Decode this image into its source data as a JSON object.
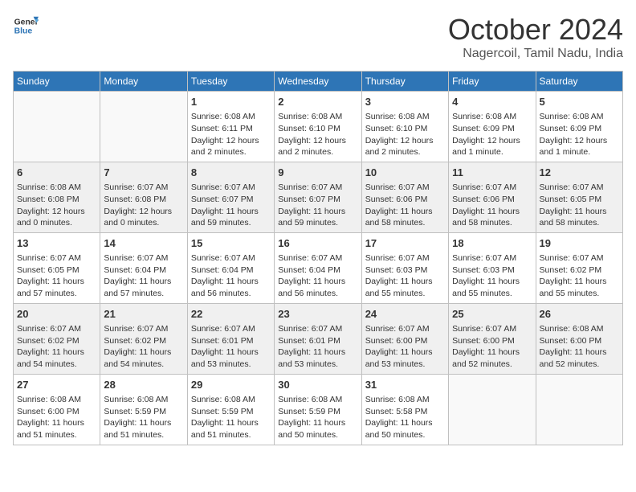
{
  "header": {
    "logo_line1": "General",
    "logo_line2": "Blue",
    "month_year": "October 2024",
    "location": "Nagercoil, Tamil Nadu, India"
  },
  "weekdays": [
    "Sunday",
    "Monday",
    "Tuesday",
    "Wednesday",
    "Thursday",
    "Friday",
    "Saturday"
  ],
  "weeks": [
    [
      {
        "day": "",
        "info": ""
      },
      {
        "day": "",
        "info": ""
      },
      {
        "day": "1",
        "info": "Sunrise: 6:08 AM\nSunset: 6:11 PM\nDaylight: 12 hours\nand 2 minutes."
      },
      {
        "day": "2",
        "info": "Sunrise: 6:08 AM\nSunset: 6:10 PM\nDaylight: 12 hours\nand 2 minutes."
      },
      {
        "day": "3",
        "info": "Sunrise: 6:08 AM\nSunset: 6:10 PM\nDaylight: 12 hours\nand 2 minutes."
      },
      {
        "day": "4",
        "info": "Sunrise: 6:08 AM\nSunset: 6:09 PM\nDaylight: 12 hours\nand 1 minute."
      },
      {
        "day": "5",
        "info": "Sunrise: 6:08 AM\nSunset: 6:09 PM\nDaylight: 12 hours\nand 1 minute."
      }
    ],
    [
      {
        "day": "6",
        "info": "Sunrise: 6:08 AM\nSunset: 6:08 PM\nDaylight: 12 hours\nand 0 minutes."
      },
      {
        "day": "7",
        "info": "Sunrise: 6:07 AM\nSunset: 6:08 PM\nDaylight: 12 hours\nand 0 minutes."
      },
      {
        "day": "8",
        "info": "Sunrise: 6:07 AM\nSunset: 6:07 PM\nDaylight: 11 hours\nand 59 minutes."
      },
      {
        "day": "9",
        "info": "Sunrise: 6:07 AM\nSunset: 6:07 PM\nDaylight: 11 hours\nand 59 minutes."
      },
      {
        "day": "10",
        "info": "Sunrise: 6:07 AM\nSunset: 6:06 PM\nDaylight: 11 hours\nand 58 minutes."
      },
      {
        "day": "11",
        "info": "Sunrise: 6:07 AM\nSunset: 6:06 PM\nDaylight: 11 hours\nand 58 minutes."
      },
      {
        "day": "12",
        "info": "Sunrise: 6:07 AM\nSunset: 6:05 PM\nDaylight: 11 hours\nand 58 minutes."
      }
    ],
    [
      {
        "day": "13",
        "info": "Sunrise: 6:07 AM\nSunset: 6:05 PM\nDaylight: 11 hours\nand 57 minutes."
      },
      {
        "day": "14",
        "info": "Sunrise: 6:07 AM\nSunset: 6:04 PM\nDaylight: 11 hours\nand 57 minutes."
      },
      {
        "day": "15",
        "info": "Sunrise: 6:07 AM\nSunset: 6:04 PM\nDaylight: 11 hours\nand 56 minutes."
      },
      {
        "day": "16",
        "info": "Sunrise: 6:07 AM\nSunset: 6:04 PM\nDaylight: 11 hours\nand 56 minutes."
      },
      {
        "day": "17",
        "info": "Sunrise: 6:07 AM\nSunset: 6:03 PM\nDaylight: 11 hours\nand 55 minutes."
      },
      {
        "day": "18",
        "info": "Sunrise: 6:07 AM\nSunset: 6:03 PM\nDaylight: 11 hours\nand 55 minutes."
      },
      {
        "day": "19",
        "info": "Sunrise: 6:07 AM\nSunset: 6:02 PM\nDaylight: 11 hours\nand 55 minutes."
      }
    ],
    [
      {
        "day": "20",
        "info": "Sunrise: 6:07 AM\nSunset: 6:02 PM\nDaylight: 11 hours\nand 54 minutes."
      },
      {
        "day": "21",
        "info": "Sunrise: 6:07 AM\nSunset: 6:02 PM\nDaylight: 11 hours\nand 54 minutes."
      },
      {
        "day": "22",
        "info": "Sunrise: 6:07 AM\nSunset: 6:01 PM\nDaylight: 11 hours\nand 53 minutes."
      },
      {
        "day": "23",
        "info": "Sunrise: 6:07 AM\nSunset: 6:01 PM\nDaylight: 11 hours\nand 53 minutes."
      },
      {
        "day": "24",
        "info": "Sunrise: 6:07 AM\nSunset: 6:00 PM\nDaylight: 11 hours\nand 53 minutes."
      },
      {
        "day": "25",
        "info": "Sunrise: 6:07 AM\nSunset: 6:00 PM\nDaylight: 11 hours\nand 52 minutes."
      },
      {
        "day": "26",
        "info": "Sunrise: 6:08 AM\nSunset: 6:00 PM\nDaylight: 11 hours\nand 52 minutes."
      }
    ],
    [
      {
        "day": "27",
        "info": "Sunrise: 6:08 AM\nSunset: 6:00 PM\nDaylight: 11 hours\nand 51 minutes."
      },
      {
        "day": "28",
        "info": "Sunrise: 6:08 AM\nSunset: 5:59 PM\nDaylight: 11 hours\nand 51 minutes."
      },
      {
        "day": "29",
        "info": "Sunrise: 6:08 AM\nSunset: 5:59 PM\nDaylight: 11 hours\nand 51 minutes."
      },
      {
        "day": "30",
        "info": "Sunrise: 6:08 AM\nSunset: 5:59 PM\nDaylight: 11 hours\nand 50 minutes."
      },
      {
        "day": "31",
        "info": "Sunrise: 6:08 AM\nSunset: 5:58 PM\nDaylight: 11 hours\nand 50 minutes."
      },
      {
        "day": "",
        "info": ""
      },
      {
        "day": "",
        "info": ""
      }
    ]
  ]
}
